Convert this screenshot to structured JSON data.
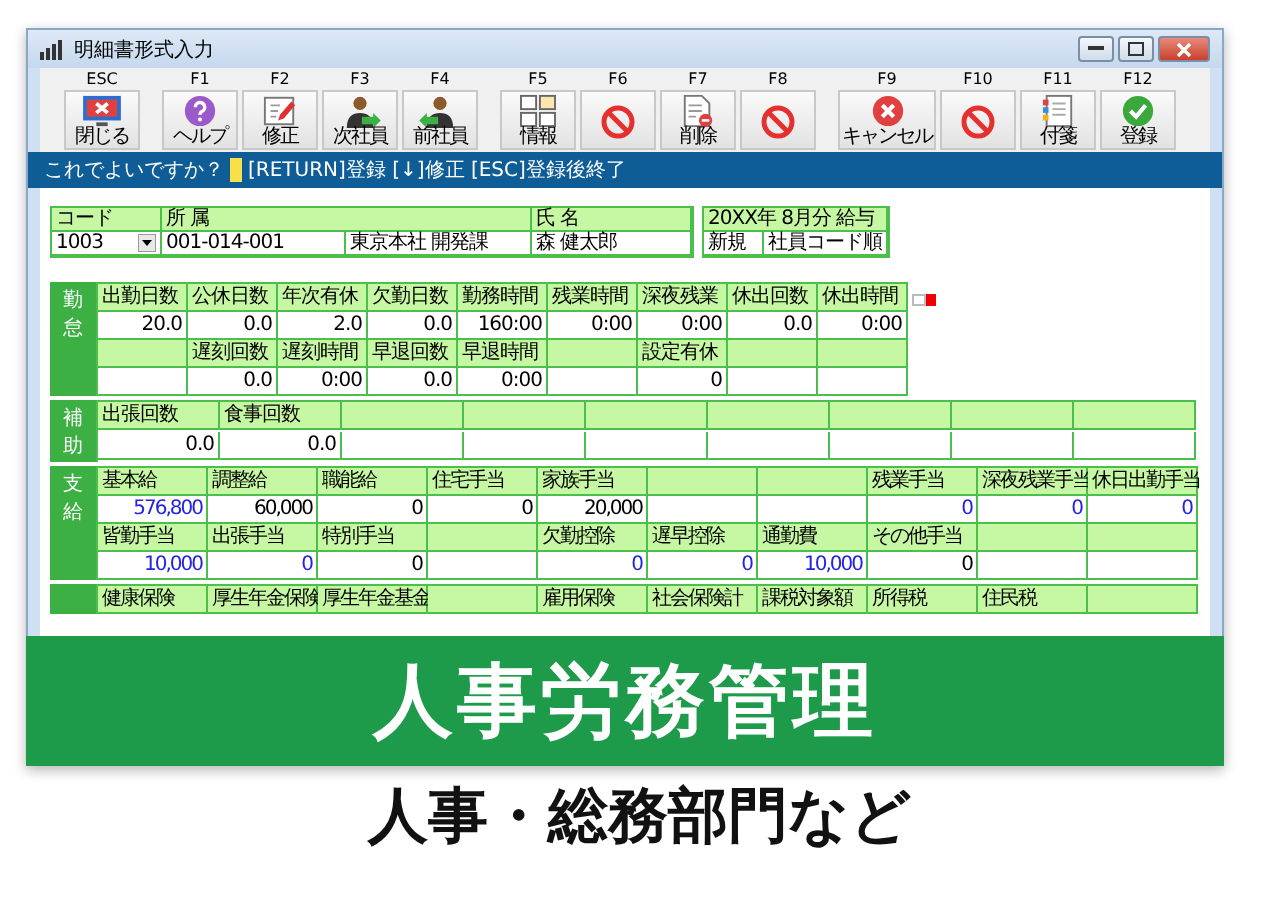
{
  "window": {
    "title": "明細書形式入力"
  },
  "toolbar": {
    "buttons": [
      {
        "key": "ESC",
        "label": "閉じる",
        "kind": "close"
      },
      {
        "key": "F1",
        "label": "ヘルプ",
        "kind": "help"
      },
      {
        "key": "F2",
        "label": "修正",
        "kind": "edit"
      },
      {
        "key": "F3",
        "label": "次社員",
        "kind": "next"
      },
      {
        "key": "F4",
        "label": "前社員",
        "kind": "prev"
      },
      {
        "key": "F5",
        "label": "情報",
        "kind": "info"
      },
      {
        "key": "F6",
        "kind": "disabled"
      },
      {
        "key": "F7",
        "label": "削除",
        "kind": "delete"
      },
      {
        "key": "F8",
        "kind": "disabled"
      },
      {
        "key": "F9",
        "label": "キャンセル",
        "kind": "cancel"
      },
      {
        "key": "F10",
        "kind": "disabled"
      },
      {
        "key": "F11",
        "label": "付箋",
        "kind": "note"
      },
      {
        "key": "F12",
        "label": "登録",
        "kind": "ok"
      }
    ]
  },
  "message": {
    "prompt": "これでよいですか？",
    "hint": "[RETURN]登録 [↓]修正 [ESC]登録後終了"
  },
  "employee": {
    "labels": [
      "コード",
      "所 属",
      "氏 名"
    ],
    "code": "1003",
    "dept_code": "001-014-001",
    "dept_name": "東京本社 開発課",
    "name": "森 健太郎"
  },
  "period": {
    "title": "20XX年 8月分 給与",
    "mode": "新規",
    "order": "社員コード順"
  },
  "sections": [
    {
      "label": "勤怠",
      "rows": [
        {
          "kind": "labels",
          "cells": [
            "出勤日数",
            "公休日数",
            "年次有休",
            "欠勤日数",
            "勤務時間",
            "残業時間",
            "深夜残業",
            "休出回数",
            "休出時間"
          ]
        },
        {
          "kind": "values",
          "cells": [
            "20.0",
            "0.0",
            "2.0",
            "0.0",
            "160:00",
            "0:00",
            "0:00",
            "0.0",
            "0:00"
          ]
        },
        {
          "kind": "labels",
          "cells": [
            null,
            "遅刻回数",
            "遅刻時間",
            "早退回数",
            "早退時間",
            null,
            "設定有休",
            null,
            null
          ]
        },
        {
          "kind": "values",
          "cells": [
            null,
            "0.0",
            "0:00",
            "0.0",
            "0:00",
            null,
            "0",
            null,
            null
          ]
        }
      ]
    },
    {
      "label": "補助",
      "rows": [
        {
          "kind": "labels",
          "cells": [
            "出張回数",
            "食事回数",
            null,
            null,
            null,
            null,
            null,
            null,
            null
          ]
        },
        {
          "kind": "values",
          "cells": [
            "0.0",
            "0.0",
            null,
            null,
            null,
            null,
            null,
            null,
            null
          ]
        }
      ]
    },
    {
      "label": "支給",
      "rows": [
        {
          "kind": "labels",
          "cells": [
            "基本給",
            "調整給",
            "職能給",
            "住宅手当",
            "家族手当",
            null,
            null,
            "残業手当",
            "深夜残業手当",
            "休日出勤手当"
          ]
        },
        {
          "kind": "values",
          "cells": [
            "576,800",
            "60,000",
            "0",
            "0",
            "20,000",
            null,
            null,
            "0",
            "0",
            "0"
          ],
          "emphasis": [
            true,
            false,
            false,
            false,
            false,
            false,
            false,
            true,
            true,
            true
          ]
        },
        {
          "kind": "labels",
          "cells": [
            "皆勤手当",
            "出張手当",
            "特別手当",
            null,
            "欠勤控除",
            "遅早控除",
            "通勤費",
            "その他手当",
            null,
            null
          ]
        },
        {
          "kind": "values",
          "cells": [
            "10,000",
            "0",
            "0",
            null,
            "0",
            "0",
            "10,000",
            "0",
            null,
            null
          ],
          "emphasis": [
            true,
            true,
            false,
            false,
            true,
            true,
            true,
            false,
            false,
            false
          ]
        }
      ]
    },
    {
      "rows": [
        {
          "kind": "labels",
          "cells": [
            "健康保険",
            "厚生年金保険",
            "厚生年金基金",
            null,
            "雇用保険",
            "社会保険計",
            "課税対象額",
            "所得税",
            "住民税",
            null
          ]
        }
      ]
    }
  ],
  "banner": "人事労務管理",
  "caption": "人事・総務部門など"
}
